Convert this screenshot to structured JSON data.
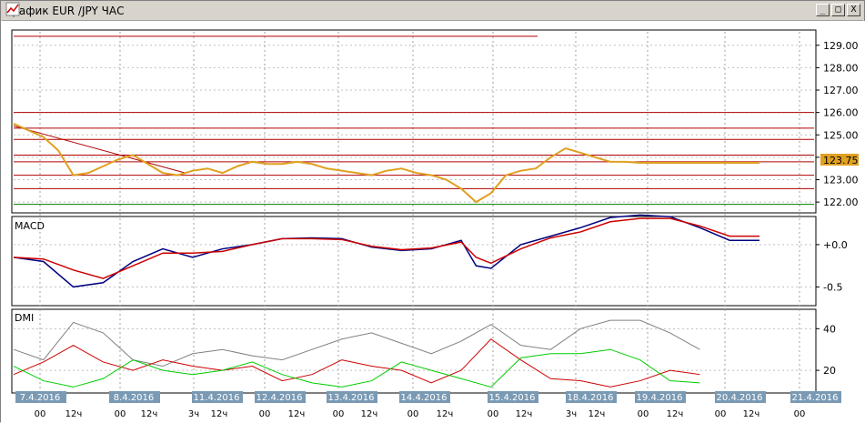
{
  "window": {
    "title": "График EUR /JPY  ЧАС",
    "buttons": [
      "_",
      "□",
      "X"
    ]
  },
  "chart_data": [
    {
      "type": "line",
      "panel": "price",
      "ylim": [
        121.6,
        129.6
      ],
      "yticks": [
        "129.00",
        "128.00",
        "127.00",
        "126.00",
        "125.00",
        "124.00",
        "123.00",
        "122.00"
      ],
      "current_price_label": "123.75",
      "series": [
        {
          "color": "#e0a020",
          "x": [
            0,
            2,
            4,
            6,
            8,
            10,
            12,
            14,
            16,
            18,
            20,
            22,
            24,
            26,
            28,
            30,
            32,
            34,
            36,
            38,
            40,
            42,
            44,
            46,
            48,
            50,
            52,
            54,
            56,
            58,
            60,
            62,
            64,
            66,
            68,
            70,
            72,
            74,
            76,
            78,
            80,
            82,
            84,
            86,
            88,
            90,
            92,
            94,
            96,
            98,
            100
          ],
          "y": [
            125.5,
            125.2,
            124.9,
            124.3,
            123.2,
            123.3,
            123.6,
            123.9,
            124.1,
            123.7,
            123.3,
            123.2,
            123.4,
            123.5,
            123.3,
            123.6,
            123.8,
            123.7,
            123.7,
            123.8,
            123.7,
            123.5,
            123.4,
            123.3,
            123.2,
            123.4,
            123.5,
            123.3,
            123.2,
            123.0,
            122.6,
            122.0,
            122.4,
            123.2,
            123.4,
            123.5,
            124.0,
            124.4,
            124.2,
            124.0,
            123.8,
            123.8,
            123.75,
            123.75,
            123.75,
            123.75,
            123.75,
            123.75,
            123.75,
            123.75,
            123.75
          ]
        }
      ],
      "horizontal_levels": [
        129.4,
        126.0,
        125.3,
        124.8,
        124.1,
        123.8,
        123.2,
        122.6
      ],
      "green_level": 121.9,
      "trendline": {
        "x": [
          0,
          23
        ],
        "y": [
          125.4,
          123.3
        ]
      }
    },
    {
      "type": "line",
      "panel": "macd",
      "title": "MACD",
      "ylim": [
        -0.7,
        0.3
      ],
      "yticks": [
        "+0.0",
        "-0.5"
      ],
      "series": [
        {
          "color": "#000080",
          "x": [
            0,
            4,
            8,
            12,
            16,
            20,
            24,
            28,
            32,
            36,
            40,
            44,
            48,
            52,
            56,
            60,
            62,
            64,
            68,
            72,
            76,
            80,
            84,
            88,
            92,
            96,
            100
          ],
          "y": [
            -0.15,
            -0.2,
            -0.5,
            -0.45,
            -0.2,
            -0.05,
            -0.15,
            -0.05,
            0.0,
            0.07,
            0.08,
            0.07,
            -0.03,
            -0.07,
            -0.05,
            0.05,
            -0.25,
            -0.28,
            0.0,
            0.1,
            0.2,
            0.32,
            0.35,
            0.33,
            0.2,
            0.05,
            0.05
          ]
        },
        {
          "color": "#cc0000",
          "x": [
            0,
            4,
            8,
            12,
            16,
            20,
            24,
            28,
            32,
            36,
            40,
            44,
            48,
            52,
            56,
            60,
            62,
            64,
            68,
            72,
            76,
            80,
            84,
            88,
            92,
            96,
            100
          ],
          "y": [
            -0.15,
            -0.17,
            -0.3,
            -0.4,
            -0.25,
            -0.1,
            -0.1,
            -0.08,
            0.0,
            0.07,
            0.07,
            0.06,
            -0.02,
            -0.06,
            -0.04,
            0.03,
            -0.15,
            -0.22,
            -0.05,
            0.08,
            0.15,
            0.27,
            0.31,
            0.31,
            0.22,
            0.1,
            0.1
          ]
        }
      ]
    },
    {
      "type": "line",
      "panel": "dmi",
      "title": "DMI",
      "ylim": [
        10,
        48
      ],
      "yticks": [
        "40",
        "20"
      ],
      "series": [
        {
          "color": "#808080",
          "x": [
            0,
            4,
            8,
            12,
            16,
            20,
            24,
            28,
            32,
            36,
            40,
            44,
            48,
            52,
            56,
            60,
            64,
            68,
            72,
            76,
            80,
            84,
            88,
            92
          ],
          "y": [
            30,
            25,
            43,
            38,
            25,
            22,
            28,
            30,
            27,
            25,
            30,
            35,
            38,
            33,
            28,
            34,
            42,
            32,
            30,
            40,
            44,
            44,
            38,
            30
          ]
        },
        {
          "color": "#cc0000",
          "x": [
            0,
            4,
            8,
            12,
            16,
            20,
            24,
            28,
            32,
            36,
            40,
            44,
            48,
            52,
            56,
            60,
            64,
            68,
            72,
            76,
            80,
            84,
            88,
            92
          ],
          "y": [
            18,
            24,
            32,
            24,
            20,
            25,
            22,
            20,
            22,
            15,
            18,
            25,
            22,
            20,
            14,
            20,
            35,
            25,
            16,
            15,
            12,
            15,
            20,
            18
          ]
        },
        {
          "color": "#00cc00",
          "x": [
            0,
            4,
            8,
            12,
            16,
            20,
            24,
            28,
            32,
            36,
            40,
            44,
            48,
            52,
            56,
            60,
            64,
            68,
            72,
            76,
            80,
            84,
            88,
            92
          ],
          "y": [
            22,
            15,
            12,
            16,
            25,
            20,
            18,
            20,
            24,
            18,
            14,
            12,
            15,
            24,
            20,
            16,
            12,
            26,
            28,
            28,
            30,
            25,
            15,
            14
          ]
        }
      ]
    }
  ],
  "x_axis": {
    "dates": [
      "7.4.2016",
      "8.4.2016",
      "11.4.2016",
      "12.4.2016",
      "13.4.2016",
      "14.4.2016",
      "15.4.2016",
      "18.4.2016",
      "19.4.2016",
      "20.4.2016",
      "21.4.2016"
    ],
    "hours": [
      "00",
      "12ч",
      "00",
      "12ч",
      "3ч",
      "12ч",
      "00",
      "12ч",
      "00",
      "12ч",
      "00",
      "12ч",
      "00",
      "12ч",
      "3ч",
      "12ч",
      "00",
      "12ч",
      "00",
      "12ч",
      "00"
    ]
  }
}
